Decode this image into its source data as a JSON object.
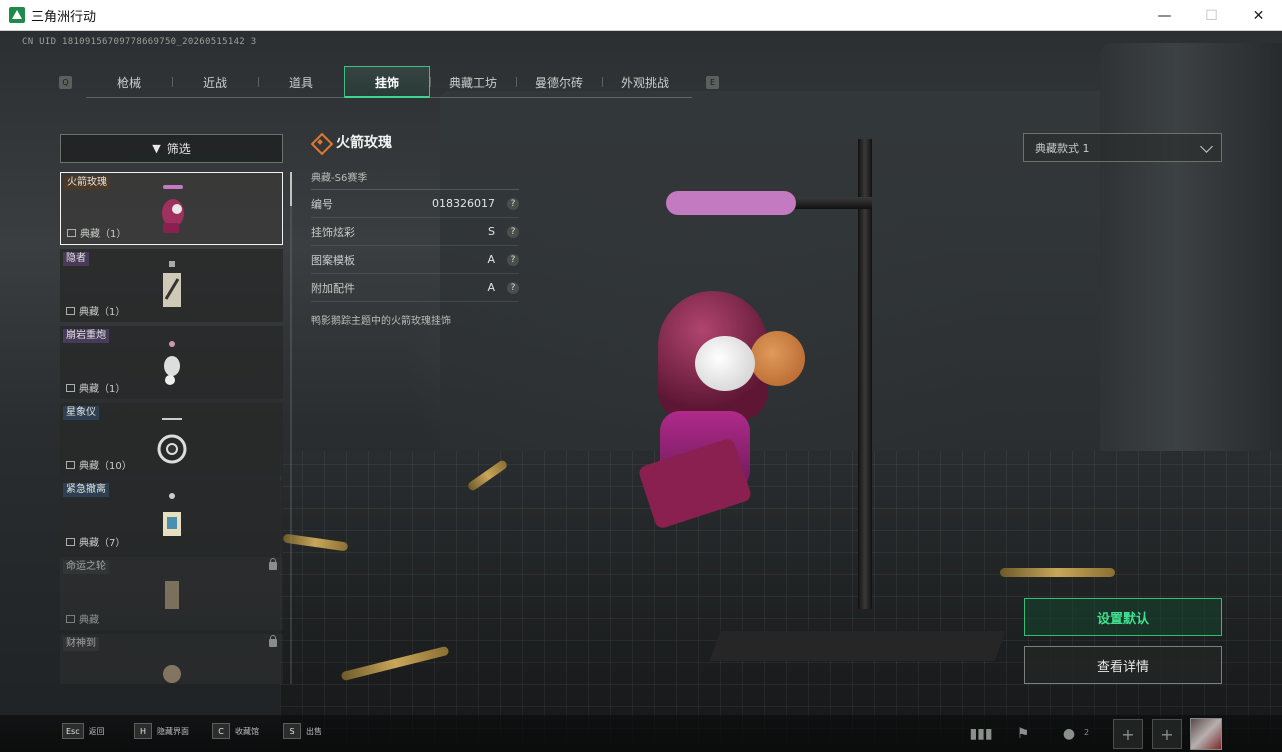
{
  "window": {
    "title": "三角洲行动",
    "controls": {
      "minimize": "—",
      "maximize": "☐",
      "close": "✕"
    }
  },
  "uid": "CN UID 18109156709778669750_20260515142 3",
  "tabs": [
    {
      "label": "枪械",
      "active": false
    },
    {
      "label": "近战",
      "active": false
    },
    {
      "label": "道具",
      "active": false
    },
    {
      "label": "挂饰",
      "active": true
    },
    {
      "label": "典藏工坊",
      "active": false
    },
    {
      "label": "曼德尔砖",
      "active": false
    },
    {
      "label": "外观挑战",
      "active": false
    }
  ],
  "tab_keys": {
    "left": "Q",
    "right": "E"
  },
  "filter": {
    "label": "筛选"
  },
  "items": [
    {
      "name": "火箭玫瑰",
      "count": "典藏（1）",
      "tag": "brown",
      "selected": true,
      "locked": false
    },
    {
      "name": "隐者",
      "count": "典藏（1）",
      "tag": "purple",
      "selected": false,
      "locked": false
    },
    {
      "name": "崩岩重炮",
      "count": "典藏（1）",
      "tag": "purple",
      "selected": false,
      "locked": false
    },
    {
      "name": "星象仪",
      "count": "典藏（10）",
      "tag": "blue",
      "selected": false,
      "locked": false
    },
    {
      "name": "紧急撤离",
      "count": "典藏（7）",
      "tag": "blue",
      "selected": false,
      "locked": false
    },
    {
      "name": "命运之轮",
      "count": "典藏",
      "tag": "gray",
      "selected": false,
      "locked": true
    },
    {
      "name": "财神到",
      "count": "",
      "tag": "gray",
      "selected": false,
      "locked": true
    }
  ],
  "detail": {
    "title": "火箭玫瑰",
    "season": "典藏-S6赛季",
    "props": [
      {
        "label": "编号",
        "value": "018326017"
      },
      {
        "label": "挂饰炫彩",
        "value": "S"
      },
      {
        "label": "图案模板",
        "value": "A"
      },
      {
        "label": "附加配件",
        "value": "A"
      }
    ],
    "help": "?",
    "description": "鸭影鹅踪主题中的火箭玫瑰挂饰"
  },
  "style_select": {
    "value": "典藏款式 1"
  },
  "actions": {
    "set_default": "设置默认",
    "view_details": "查看详情"
  },
  "hotkeys": [
    {
      "key": "Esc",
      "label": "返回"
    },
    {
      "key": "H",
      "label": "隐藏界面"
    },
    {
      "key": "C",
      "label": "收藏馆"
    },
    {
      "key": "S",
      "label": "出售"
    }
  ],
  "tray": {
    "friends_count": "2",
    "add": "+"
  },
  "colors": {
    "accent": "#3fd48f",
    "rarity": "#e2782e"
  }
}
